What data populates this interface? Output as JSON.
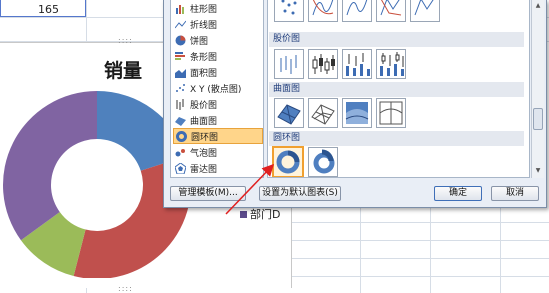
{
  "sheet": {
    "cell_value": "165"
  },
  "chart": {
    "title": "销量",
    "legend_label": "部门D",
    "chart_data": {
      "type": "pie",
      "series": [
        {
          "values": [
            20,
            34,
            11,
            35
          ]
        }
      ],
      "colors": [
        "#4f81bd",
        "#c0504d",
        "#9bbb59",
        "#8064a2"
      ]
    }
  },
  "dialog": {
    "types": [
      {
        "label": "柱形图",
        "icon": "column-chart-icon"
      },
      {
        "label": "折线图",
        "icon": "line-chart-icon"
      },
      {
        "label": "饼图",
        "icon": "pie-chart-icon"
      },
      {
        "label": "条形图",
        "icon": "bar-chart-icon"
      },
      {
        "label": "面积图",
        "icon": "area-chart-icon"
      },
      {
        "label": "X Y (散点图)",
        "icon": "scatter-chart-icon"
      },
      {
        "label": "股价图",
        "icon": "stock-chart-icon"
      },
      {
        "label": "曲面图",
        "icon": "surface-chart-icon"
      },
      {
        "label": "圆环图",
        "icon": "doughnut-chart-icon"
      },
      {
        "label": "气泡图",
        "icon": "bubble-chart-icon"
      },
      {
        "label": "雷达图",
        "icon": "radar-chart-icon"
      }
    ],
    "selected_type": "圆环图",
    "groups": {
      "stock": "股价图",
      "surface": "曲面图",
      "doughnut": "圆环图"
    },
    "buttons": {
      "manage_templates": "管理模板(M)...",
      "set_default": "设置为默认图表(S)",
      "ok": "确定",
      "cancel": "取消"
    },
    "colors": {
      "selection_fill": "#ffd58a",
      "selection_border": "#e8a33c",
      "annotation_arrow": "#e02020"
    }
  }
}
